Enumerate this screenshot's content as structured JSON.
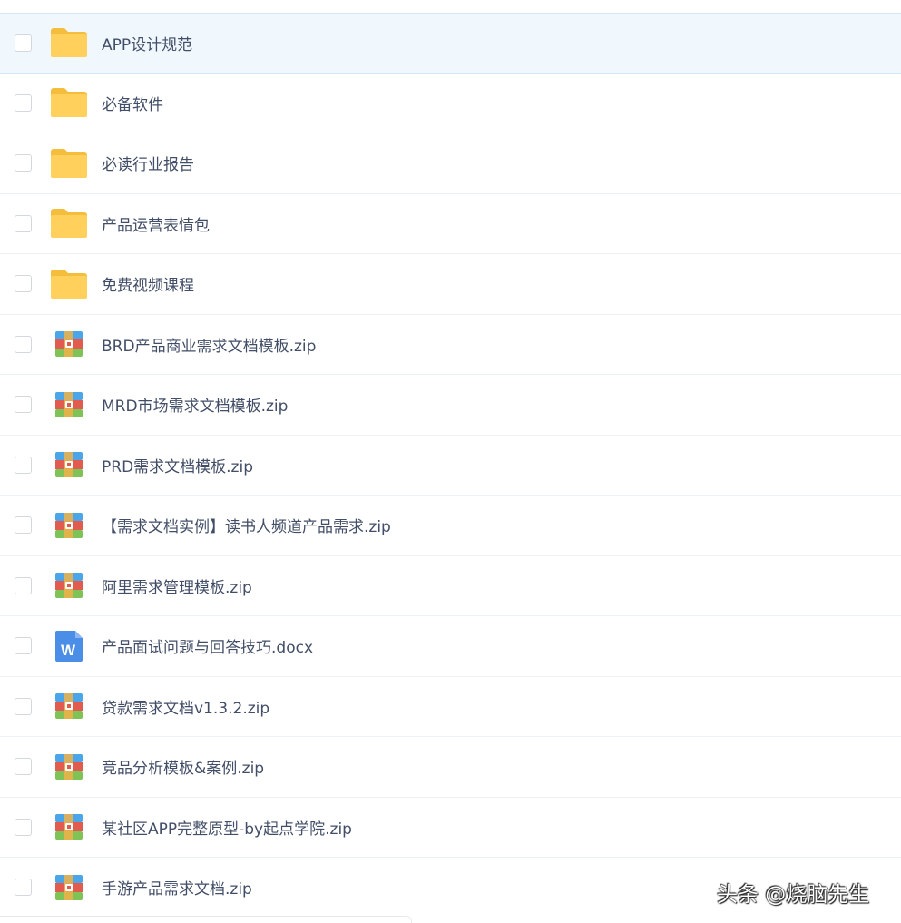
{
  "files": [
    {
      "name": "APP设计规范",
      "type": "folder",
      "icon": "folder-icon",
      "selected": true
    },
    {
      "name": "必备软件",
      "type": "folder",
      "icon": "folder-icon",
      "selected": false
    },
    {
      "name": "必读行业报告",
      "type": "folder",
      "icon": "folder-icon",
      "selected": false
    },
    {
      "name": "产品运营表情包",
      "type": "folder",
      "icon": "folder-icon",
      "selected": false
    },
    {
      "name": "免费视频课程",
      "type": "folder",
      "icon": "folder-icon",
      "selected": false
    },
    {
      "name": "BRD产品商业需求文档模板.zip",
      "type": "zip",
      "icon": "zip-archive-icon",
      "selected": false
    },
    {
      "name": "MRD市场需求文档模板.zip",
      "type": "zip",
      "icon": "zip-archive-icon",
      "selected": false
    },
    {
      "name": "PRD需求文档模板.zip",
      "type": "zip",
      "icon": "zip-archive-icon",
      "selected": false
    },
    {
      "name": "【需求文档实例】读书人频道产品需求.zip",
      "type": "zip",
      "icon": "zip-archive-icon",
      "selected": false
    },
    {
      "name": "阿里需求管理模板.zip",
      "type": "zip",
      "icon": "zip-archive-icon",
      "selected": false
    },
    {
      "name": "产品面试问题与回答技巧.docx",
      "type": "docx",
      "icon": "word-document-icon",
      "selected": false
    },
    {
      "name": "贷款需求文档v1.3.2.zip",
      "type": "zip",
      "icon": "zip-archive-icon",
      "selected": false
    },
    {
      "name": "竞品分析模板&案例.zip",
      "type": "zip",
      "icon": "zip-archive-icon",
      "selected": false
    },
    {
      "name": "某社区APP完整原型-by起点学院.zip",
      "type": "zip",
      "icon": "zip-archive-icon",
      "selected": false
    },
    {
      "name": "手游产品需求文档.zip",
      "type": "zip",
      "icon": "zip-archive-icon",
      "selected": false
    }
  ],
  "watermark": "头条 @烧脑先生",
  "colors": {
    "folder": "#ffd15c",
    "folder_tab": "#f5bd3c",
    "zip_blue": "#4aa6e8",
    "zip_red": "#e25b4f",
    "zip_green": "#7fc255",
    "zip_buckle": "#f0b34a",
    "docx_blue": "#4a8ee8",
    "selected_row": "#f0f8fe"
  }
}
